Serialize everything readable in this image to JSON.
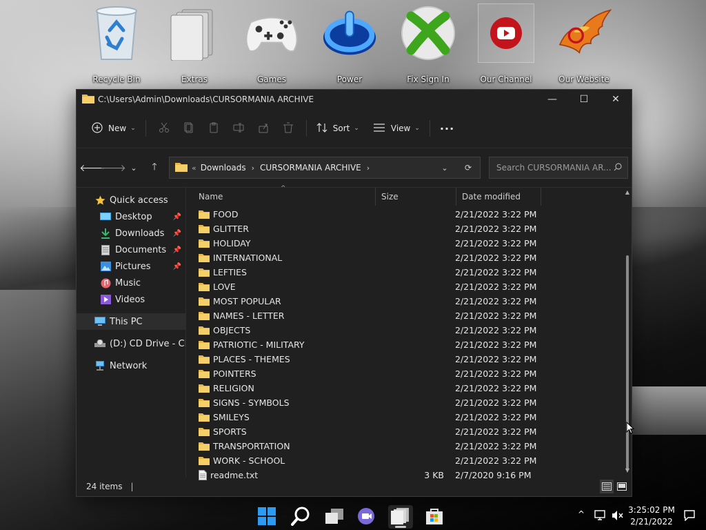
{
  "desktop": {
    "icons": [
      {
        "label": "Recycle Bin",
        "icon": "recycle-bin-icon"
      },
      {
        "label": "Extras",
        "icon": "folder-stack-icon"
      },
      {
        "label": "Games",
        "icon": "gamepad-icon"
      },
      {
        "label": "Power",
        "icon": "power-icon"
      },
      {
        "label": "Fix Sign In",
        "icon": "xbox-icon"
      },
      {
        "label": "Our Channel",
        "icon": "youtube-icon"
      },
      {
        "label": "Our Website",
        "icon": "phoenix-logo-icon"
      }
    ]
  },
  "window": {
    "title": "C:\\Users\\Admin\\Downloads\\CURSORMANIA ARCHIVE",
    "controls": {
      "minimize": "—",
      "maximize": "☐",
      "close": "✕"
    }
  },
  "commandbar": {
    "new_label": "New",
    "sort_label": "Sort",
    "view_label": "View",
    "more_label": "···"
  },
  "address": {
    "lead": "«",
    "crumbs": [
      "Downloads",
      "CURSORMANIA ARCHIVE"
    ],
    "search_placeholder": "Search CURSORMANIA AR..."
  },
  "navpane": {
    "quick_access": "Quick access",
    "pinned": [
      "Desktop",
      "Downloads",
      "Documents",
      "Pictures"
    ],
    "unpinned": [
      "Music",
      "Videos"
    ],
    "this_pc": "This PC",
    "cd_drive": "(D:) CD Drive - CDROM",
    "network": "Network"
  },
  "columns": {
    "name": "Name",
    "size": "Size",
    "date": "Date modified"
  },
  "files": [
    {
      "name": "FOOD",
      "size": "",
      "date": "2/21/2022 3:22 PM",
      "type": "folder"
    },
    {
      "name": "GLITTER",
      "size": "",
      "date": "2/21/2022 3:22 PM",
      "type": "folder"
    },
    {
      "name": "HOLIDAY",
      "size": "",
      "date": "2/21/2022 3:22 PM",
      "type": "folder"
    },
    {
      "name": "INTERNATIONAL",
      "size": "",
      "date": "2/21/2022 3:22 PM",
      "type": "folder"
    },
    {
      "name": "LEFTIES",
      "size": "",
      "date": "2/21/2022 3:22 PM",
      "type": "folder"
    },
    {
      "name": "LOVE",
      "size": "",
      "date": "2/21/2022 3:22 PM",
      "type": "folder"
    },
    {
      "name": "MOST POPULAR",
      "size": "",
      "date": "2/21/2022 3:22 PM",
      "type": "folder"
    },
    {
      "name": "NAMES - LETTER",
      "size": "",
      "date": "2/21/2022 3:22 PM",
      "type": "folder"
    },
    {
      "name": "OBJECTS",
      "size": "",
      "date": "2/21/2022 3:22 PM",
      "type": "folder"
    },
    {
      "name": "PATRIOTIC - MILITARY",
      "size": "",
      "date": "2/21/2022 3:22 PM",
      "type": "folder"
    },
    {
      "name": "PLACES - THEMES",
      "size": "",
      "date": "2/21/2022 3:22 PM",
      "type": "folder"
    },
    {
      "name": "POINTERS",
      "size": "",
      "date": "2/21/2022 3:22 PM",
      "type": "folder"
    },
    {
      "name": "RELIGION",
      "size": "",
      "date": "2/21/2022 3:22 PM",
      "type": "folder"
    },
    {
      "name": "SIGNS - SYMBOLS",
      "size": "",
      "date": "2/21/2022 3:22 PM",
      "type": "folder"
    },
    {
      "name": "SMILEYS",
      "size": "",
      "date": "2/21/2022 3:22 PM",
      "type": "folder"
    },
    {
      "name": "SPORTS",
      "size": "",
      "date": "2/21/2022 3:22 PM",
      "type": "folder"
    },
    {
      "name": "TRANSPORTATION",
      "size": "",
      "date": "2/21/2022 3:22 PM",
      "type": "folder"
    },
    {
      "name": "WORK - SCHOOL",
      "size": "",
      "date": "2/21/2022 3:22 PM",
      "type": "folder"
    },
    {
      "name": "readme.txt",
      "size": "3 KB",
      "date": "2/7/2020 9:16 PM",
      "type": "text"
    }
  ],
  "status": {
    "item_count": "24 items",
    "separator": "|"
  },
  "taskbar": {
    "clock_time": "3:25:02 PM",
    "clock_date": "2/21/2022",
    "tray_up": "^"
  },
  "colors": {
    "folder": "#e8b84a",
    "accent": "#0078d4",
    "window_bg": "#202020"
  }
}
